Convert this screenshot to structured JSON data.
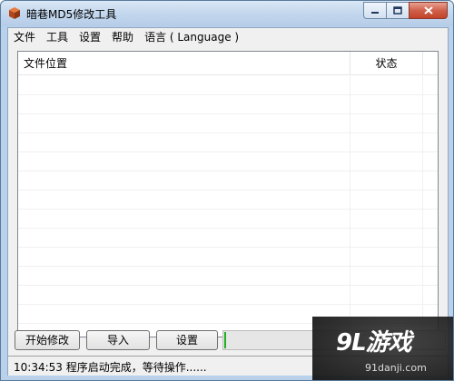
{
  "window": {
    "title": "暗巷MD5修改工具"
  },
  "menu": {
    "items": [
      {
        "label": "文件"
      },
      {
        "label": "工具"
      },
      {
        "label": "设置"
      },
      {
        "label": "帮助"
      },
      {
        "label": "语言 ( Language )"
      }
    ]
  },
  "list": {
    "columns": [
      "文件位置",
      "状态"
    ],
    "rows": []
  },
  "buttons": {
    "start": "开始修改",
    "import": "导入",
    "settings": "设置"
  },
  "progress": {
    "value_fraction": 0.01,
    "fill_color": "#1fb11f"
  },
  "status": {
    "text": "10:34:53 程序启动完成，等待操作......"
  },
  "watermark": {
    "logo": "9L游戏",
    "url": "91danji.com"
  },
  "icons": {
    "app": "app-cube-icon",
    "minimize": "minimize-icon",
    "maximize": "maximize-icon",
    "close": "close-icon"
  }
}
